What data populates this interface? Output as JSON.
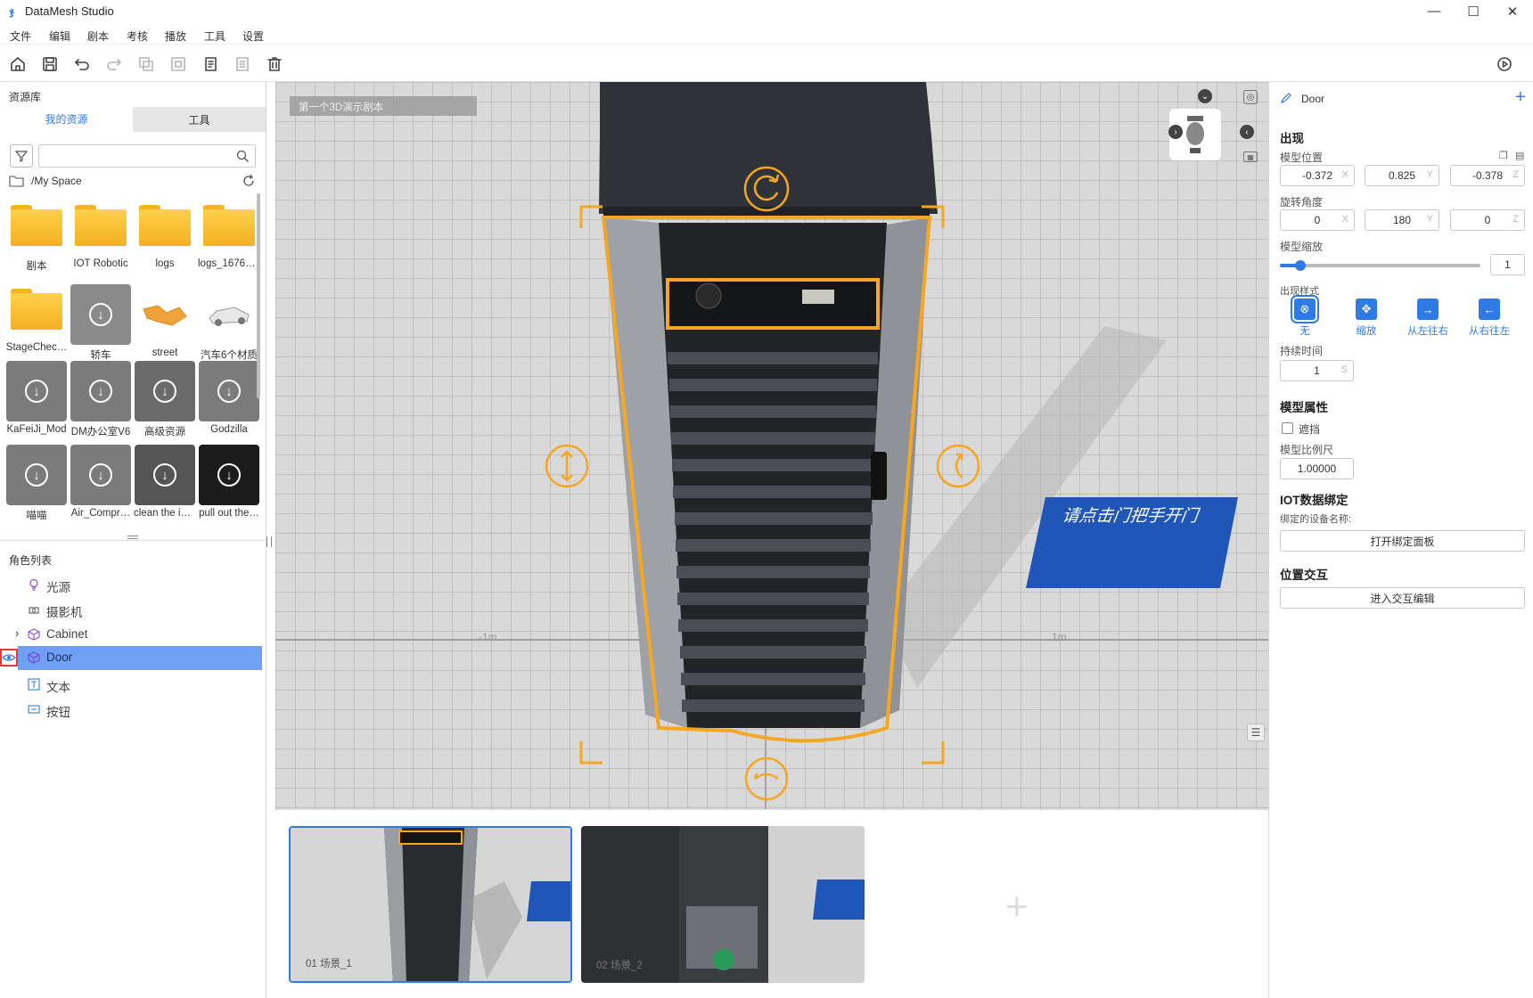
{
  "app": {
    "title": "DataMesh Studio",
    "icon": "datamesh-logo"
  },
  "menu": [
    "文件",
    "编辑",
    "剧本",
    "考核",
    "播放",
    "工具",
    "设置"
  ],
  "toolbar": [
    "home-icon",
    "save-icon",
    "undo-icon",
    "redo-icon",
    "group-icon",
    "ungroup-icon",
    "copy-icon",
    "paste-icon",
    "delete-icon"
  ],
  "resources": {
    "title": "资源库",
    "tabs": {
      "mine": "我的资源",
      "tools": "工具"
    },
    "path": "/My Space",
    "items": [
      {
        "label": "剧本",
        "kind": "folder"
      },
      {
        "label": "IOT Robotic",
        "kind": "folder"
      },
      {
        "label": "logs",
        "kind": "folder"
      },
      {
        "label": "logs_16765…",
        "kind": "folder"
      },
      {
        "label": "StageChec…",
        "kind": "folder"
      },
      {
        "label": "轿车",
        "kind": "download"
      },
      {
        "label": "street",
        "kind": "model"
      },
      {
        "label": "汽车6个材质",
        "kind": "model"
      },
      {
        "label": "KaFeiJi_Mod",
        "kind": "download"
      },
      {
        "label": "DM办公室V6",
        "kind": "download"
      },
      {
        "label": "高级资源",
        "kind": "download"
      },
      {
        "label": "Godzilla",
        "kind": "download"
      },
      {
        "label": "喵喵",
        "kind": "download"
      },
      {
        "label": "Air_Compr…",
        "kind": "download"
      },
      {
        "label": "clean the in…",
        "kind": "download"
      },
      {
        "label": "pull out the…",
        "kind": "download"
      }
    ]
  },
  "roles": {
    "title": "角色列表",
    "items": [
      {
        "label": "光源",
        "icon": "light-bulb-icon"
      },
      {
        "label": "摄影机",
        "icon": "camera-icon"
      },
      {
        "label": "Cabinet",
        "icon": "cube-icon"
      },
      {
        "label": "Door",
        "icon": "cube-icon",
        "selected": true
      },
      {
        "label": "文本",
        "icon": "text-icon"
      },
      {
        "label": "按钮",
        "icon": "button-icon"
      }
    ]
  },
  "viewport": {
    "script_name": "第一个3D演示剧本",
    "scene_text": "请点击门把手开门",
    "axis_neg": "-1m",
    "axis_pos": "1m"
  },
  "properties": {
    "name": "Door",
    "appear_title": "出现",
    "position_label": "模型位置",
    "position": {
      "x": "-0.372",
      "y": "0.825",
      "z": "-0.378"
    },
    "rotation_label": "旋转角度",
    "rotation": {
      "x": "0",
      "y": "180",
      "z": "0"
    },
    "scale_label": "模型缩放",
    "scale_value": "1",
    "scale_fraction": 0.1,
    "style_label": "出现样式",
    "styles": [
      "无",
      "缩放",
      "从左往右",
      "从右往左"
    ],
    "duration_label": "持续时间",
    "duration": "1",
    "duration_unit": "S",
    "model_attr_title": "模型属性",
    "occlude_label": "遮挡",
    "ratio_label": "模型比例尺",
    "ratio": "1.00000",
    "iot_title": "IOT数据绑定",
    "device_label": "绑定的设备名称:",
    "open_panel": "打开绑定面板",
    "pos_interact_title": "位置交互",
    "enter_interact": "进入交互编辑"
  },
  "scenes": [
    {
      "label": "01  场景_1",
      "selected": true
    },
    {
      "label": "02  场景_2",
      "selected": false
    }
  ],
  "colors": {
    "accent": "#2f7be5",
    "selection": "#f5a623",
    "selected_row": "#6ea1f5",
    "scene_panel": "#1f56b8"
  }
}
